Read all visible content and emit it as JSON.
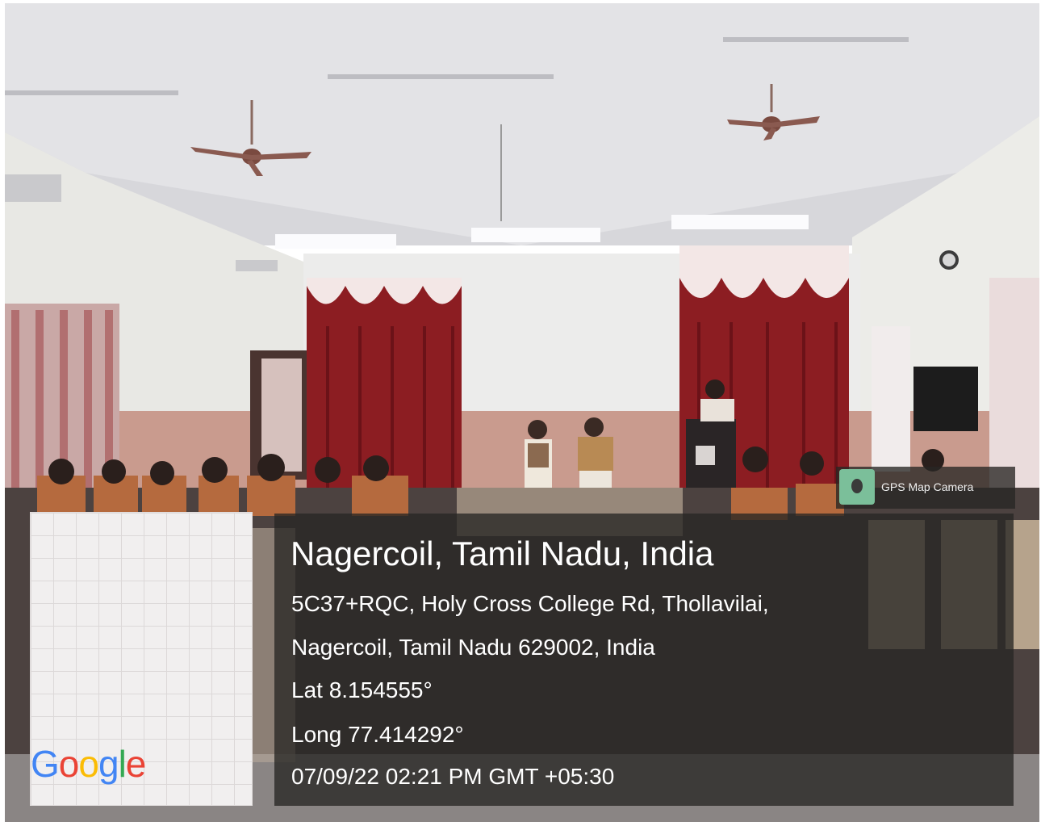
{
  "overlay": {
    "title": "Nagercoil, Tamil Nadu, India",
    "address_line_1": "5C37+RQC, Holy Cross College Rd, Thollavilai,",
    "address_line_2": "Nagercoil, Tamil Nadu 629002, India",
    "latitude": "Lat 8.154555°",
    "longitude": "Long 77.414292°",
    "datetime": "07/09/22 02:21 PM GMT +05:30"
  },
  "app_badge": {
    "name": "GPS Map Camera",
    "icon": "map-camera-app-icon"
  },
  "map": {
    "logo_text": "Google",
    "logo_colors": [
      "#4285F4",
      "#EA4335",
      "#FBBC05",
      "#4285F4",
      "#34A853",
      "#EA4335"
    ]
  }
}
